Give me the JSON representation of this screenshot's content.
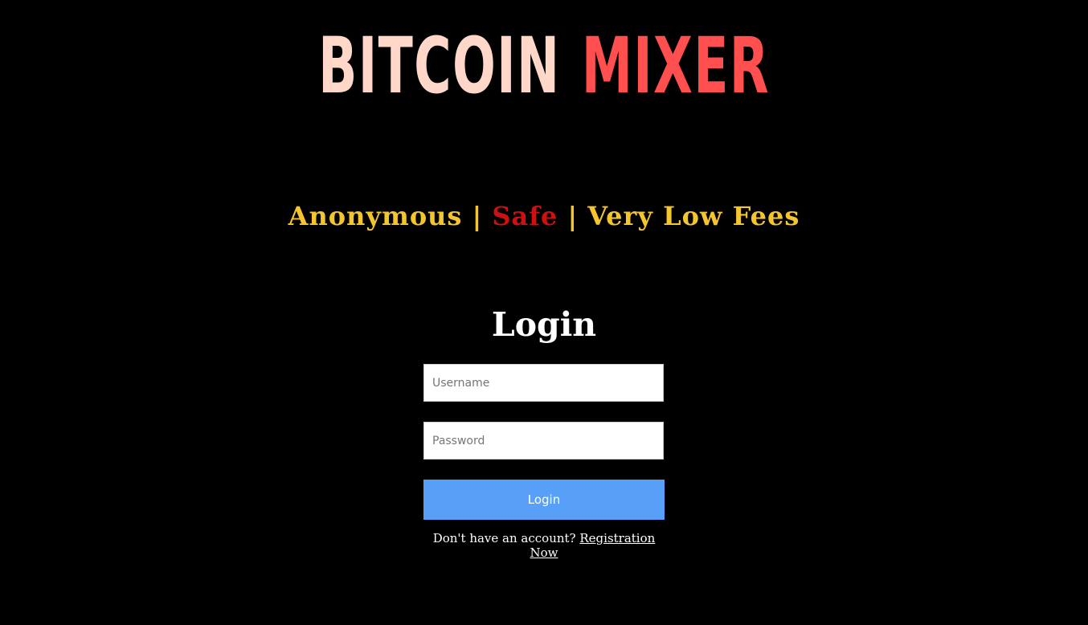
{
  "logo": {
    "word1": "BITCOIN",
    "word2": "MIXER",
    "colors": {
      "word1": "#ffd7c8",
      "word2": "#ff4f4f"
    }
  },
  "tagline": {
    "part1": "Anonymous",
    "sep1": "|",
    "part2": "Safe",
    "sep2": "|",
    "part3": "Very Low Fees",
    "colors": {
      "gold": "#f5c530",
      "red": "#cc1111"
    }
  },
  "login": {
    "title": "Login",
    "username_placeholder": "Username",
    "password_placeholder": "Password",
    "button_label": "Login",
    "button_color": "#58a0f7"
  },
  "register": {
    "prompt": "Don't have an account?",
    "link_label": "Registration Now"
  }
}
